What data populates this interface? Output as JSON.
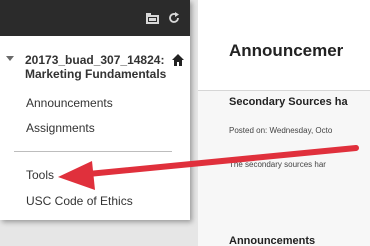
{
  "sidebar": {
    "topbar_icons": [
      "folder-icon",
      "refresh-icon"
    ],
    "course_title": "20173_buad_307_14824: Marketing Fundamentals",
    "items": [
      {
        "label": "Announcements"
      },
      {
        "label": "Assignments"
      },
      {
        "label": "Tools"
      },
      {
        "label": "USC Code of Ethics"
      }
    ]
  },
  "main": {
    "page_title": "Announcemer",
    "announcement": {
      "title": "Secondary Sources ha",
      "posted": "Posted on: Wednesday, Octo",
      "body": "The secondary sources har"
    },
    "next_section": "Announcements"
  },
  "colors": {
    "topbar": "#2b2b2b",
    "arrow": "#e0303c",
    "text": "#333333"
  }
}
